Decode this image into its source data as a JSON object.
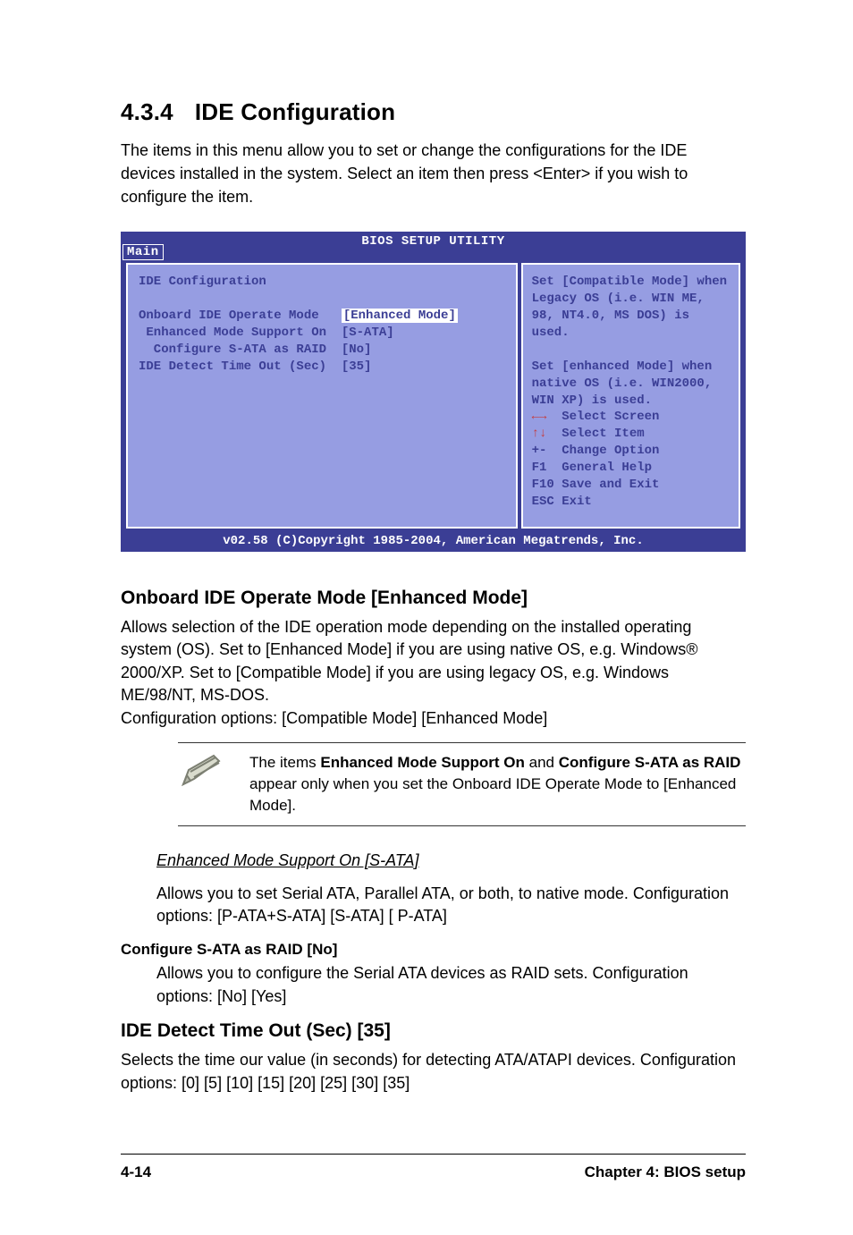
{
  "section_number": "4.3.4",
  "section_title": "IDE Configuration",
  "intro": "The items in this menu allow you to set or change the configurations for the IDE devices installed in the system. Select an item then press <Enter> if you wish to configure the item.",
  "bios": {
    "title": "BIOS SETUP UTILITY",
    "tab": "Main",
    "left_title": "IDE Configuration",
    "rows": [
      {
        "label": "Onboard IDE Operate Mode",
        "value": "[Enhanced Mode]",
        "indent": 0,
        "selected": true
      },
      {
        "label": "Enhanced Mode Support On",
        "value": "[S-ATA]",
        "indent": 1,
        "selected": false
      },
      {
        "label": "Configure S-ATA as RAID",
        "value": "[No]",
        "indent": 2,
        "selected": false
      },
      {
        "label": "IDE Detect Time Out (Sec)",
        "value": "[35]",
        "indent": 0,
        "selected": false
      }
    ],
    "help_text": "Set [Compatible Mode] when Legacy OS (i.e. WIN ME, 98, NT4.0, MS DOS) is used.\n\nSet [enhanced Mode] when native OS (i.e. WIN2000, WIN XP) is used.",
    "nav": [
      {
        "key": "←→",
        "label": "Select Screen",
        "arrow": true
      },
      {
        "key": "↑↓",
        "label": "Select Item",
        "arrow": true
      },
      {
        "key": "+-",
        "label": "Change Option",
        "arrow": false
      },
      {
        "key": "F1",
        "label": "General Help",
        "arrow": false
      },
      {
        "key": "F10",
        "label": "Save and Exit",
        "arrow": false
      },
      {
        "key": "ESC",
        "label": "Exit",
        "arrow": false
      }
    ],
    "footer": "v02.58 (C)Copyright 1985-2004, American Megatrends, Inc."
  },
  "onboard_heading": "Onboard IDE Operate Mode [Enhanced Mode]",
  "onboard_body": "Allows selection of the IDE operation mode depending on the installed operating system (OS). Set to [Enhanced Mode] if you are using native OS, e.g. Windows® 2000/XP. Set to [Compatible Mode] if you are using legacy OS, e.g. Windows ME/98/NT, MS-DOS.",
  "onboard_options": "Configuration options: [Compatible Mode] [Enhanced Mode]",
  "note_prefix": "The items ",
  "note_bold1": "Enhanced Mode Support On",
  "note_mid": " and ",
  "note_bold2": "Configure S-ATA as RAID",
  "note_suffix": " appear only when you set the Onboard IDE Operate Mode to [Enhanced Mode].",
  "enh_heading": "Enhanced Mode Support On [S-ATA]",
  "enh_body": "Allows you to set Serial ATA, Parallel ATA, or both, to native mode. Configuration options: [P-ATA+S-ATA] [S-ATA] [ P-ATA]",
  "raid_heading": "Configure S-ATA as RAID [No]",
  "raid_body": "Allows you to configure the Serial ATA devices as RAID sets. Configuration options: [No] [Yes]",
  "timeout_heading": "IDE Detect Time Out (Sec) [35]",
  "timeout_body": "Selects the time our value (in seconds) for detecting ATA/ATAPI devices. Configuration options: [0] [5] [10] [15] [20] [25] [30] [35]",
  "page_number": "4-14",
  "chapter": "Chapter 4: BIOS setup"
}
